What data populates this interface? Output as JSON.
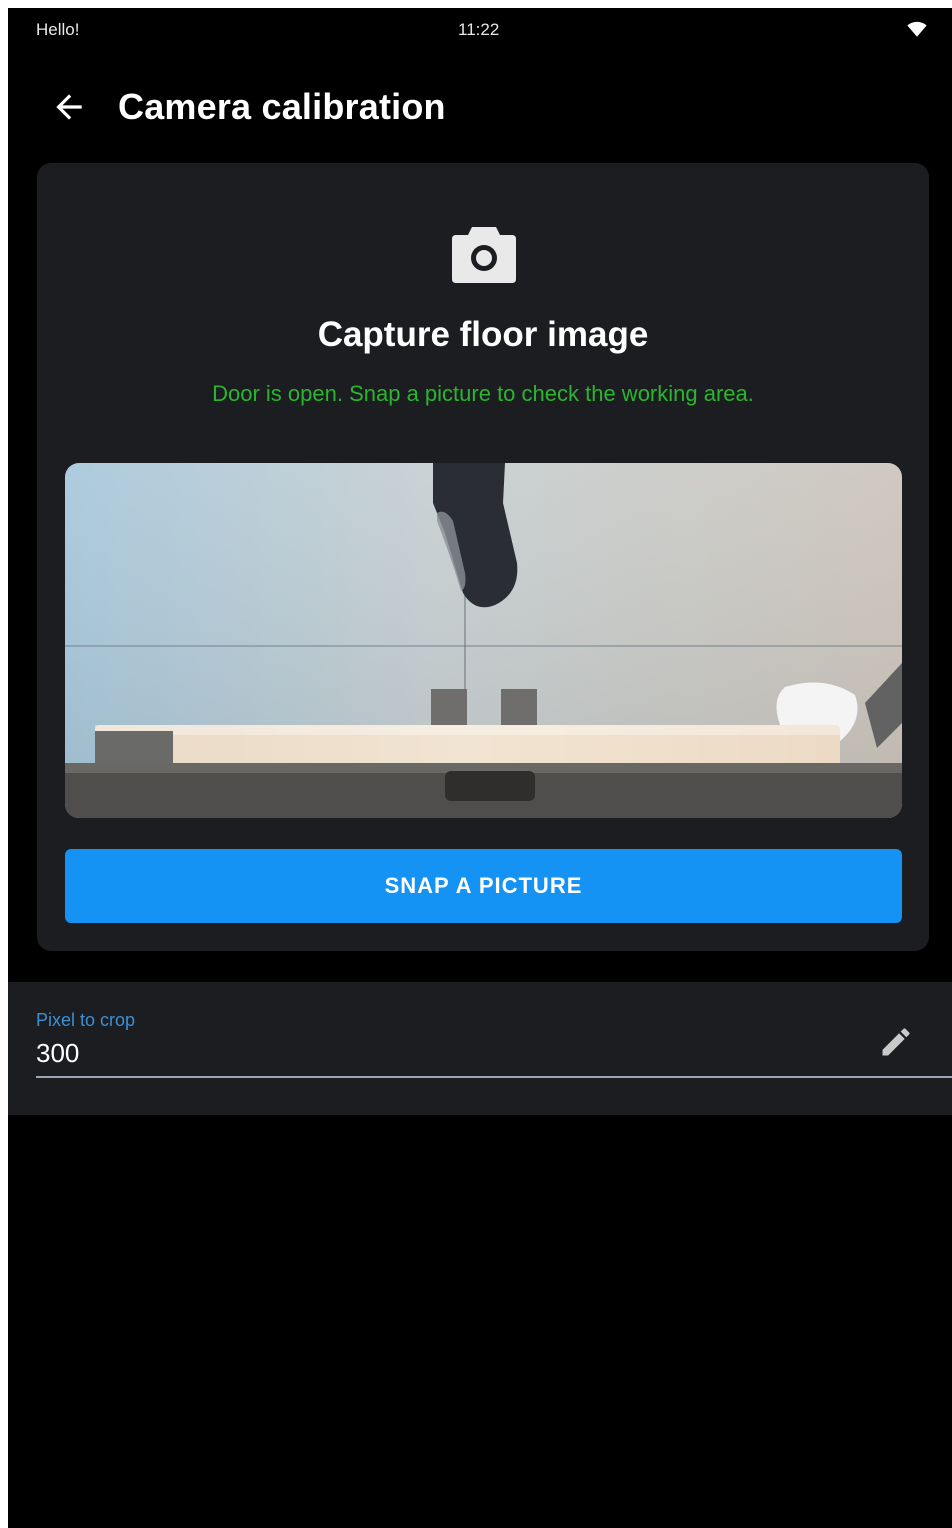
{
  "status_bar": {
    "left_text": "Hello!",
    "time": "11:22",
    "wifi_icon": "wifi-icon"
  },
  "app_bar": {
    "back_icon": "arrow-left-icon",
    "title": "Camera calibration"
  },
  "capture_card": {
    "icon": "camera-icon",
    "title": "Capture floor image",
    "status_message": "Door is open. Snap a picture to check the working area.",
    "status_color": "#2bb52e",
    "button_label": "SNAP A PICTURE",
    "button_color": "#1593f4"
  },
  "crop_field": {
    "label": "Pixel to crop",
    "value": "300",
    "edit_icon": "pencil-icon",
    "label_color": "#3d8fd6"
  },
  "colors": {
    "background": "#000000",
    "card": "#1b1d21",
    "accent": "#1593f4"
  }
}
